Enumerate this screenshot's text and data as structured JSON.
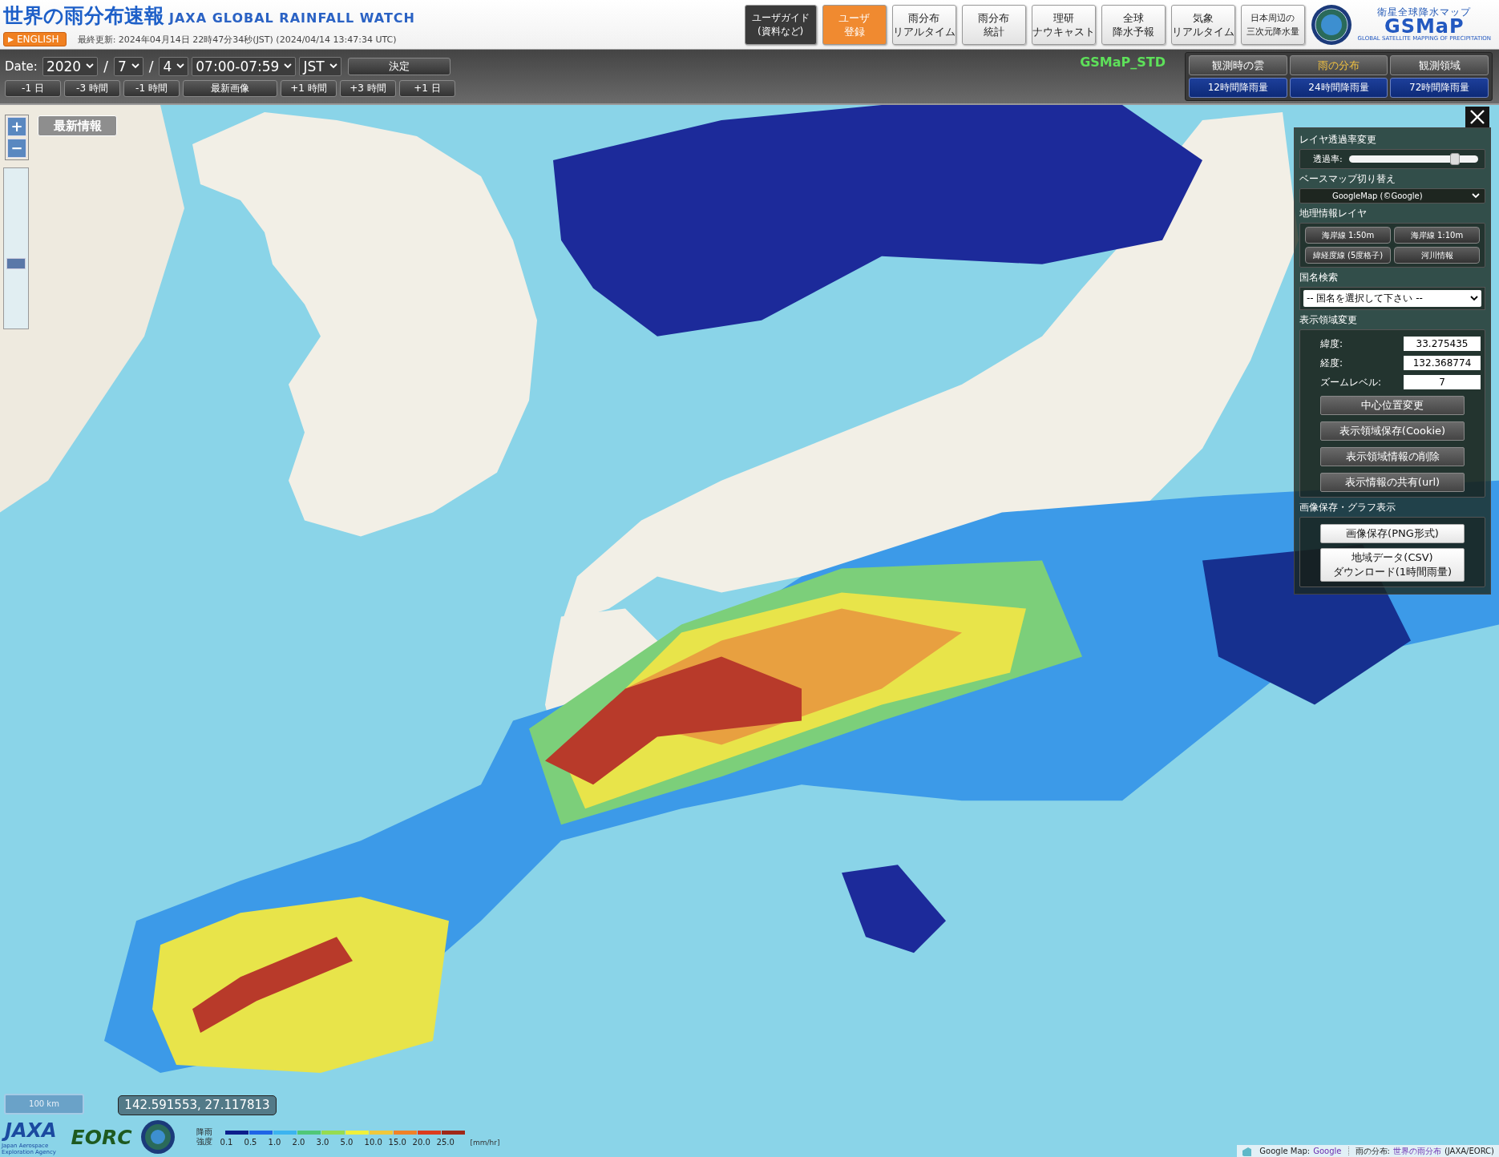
{
  "header": {
    "title": "世界の雨分布速報",
    "subtitle": "JAXA GLOBAL RAINFALL WATCH",
    "language_button": {
      "icon": "▶",
      "label": "ENGLISH"
    },
    "last_updated": "最終更新: 2024年04月14日 22時47分34秒(JST) (2024/04/14 13:47:34 UTC)"
  },
  "nav_buttons": [
    {
      "lines": [
        "ユーザガイド",
        "(資料など)"
      ],
      "kind": "dark"
    },
    {
      "lines": [
        "ユーザ",
        "登録"
      ],
      "kind": "accent"
    },
    {
      "lines": [
        "雨分布",
        "リアルタイム"
      ],
      "kind": "plain"
    },
    {
      "lines": [
        "雨分布",
        "統計"
      ],
      "kind": "plain"
    },
    {
      "lines": [
        "理研",
        "ナウキャスト"
      ],
      "kind": "plain"
    },
    {
      "lines": [
        "全球",
        "降水予報"
      ],
      "kind": "plain"
    },
    {
      "lines": [
        "気象",
        "リアルタイム"
      ],
      "kind": "plain"
    },
    {
      "lines": [
        "日本周辺の",
        "三次元降水量"
      ],
      "kind": "small"
    }
  ],
  "logo": {
    "tagline_ja": "衛星全球降水マップ",
    "name": "GSMaP",
    "tagline_en": "GLOBAL SATELLITE MAPPING OF PRECIPITATION"
  },
  "date_bar": {
    "label": "Date:",
    "fields": [
      {
        "kind": "select",
        "value": "2020"
      },
      {
        "kind": "separator",
        "text": "/"
      },
      {
        "kind": "select",
        "value": "7"
      },
      {
        "kind": "separator",
        "text": "/"
      },
      {
        "kind": "select",
        "value": "4"
      },
      {
        "kind": "select",
        "value": "07:00-07:59"
      },
      {
        "kind": "select",
        "value": "JST"
      },
      {
        "kind": "button",
        "text": "決定"
      }
    ]
  },
  "step_buttons": [
    "-1 日",
    "-3 時間",
    "-1 時間",
    "最新画像",
    "+1 時間",
    "+3 時間",
    "+1 日"
  ],
  "product": "GSMaP_STD",
  "view_tabs": [
    {
      "label": "観測時の雲",
      "selected": false
    },
    {
      "label": "雨の分布",
      "selected": true
    },
    {
      "label": "観測領域",
      "selected": false
    }
  ],
  "accum_buttons": [
    "12時間降雨量",
    "24時間降雨量",
    "72時間降雨量"
  ],
  "map": {
    "kind": "picture",
    "zoom_slider": {
      "level": 0.4
    },
    "latest_button": "最新情報",
    "zoom_in": "+",
    "zoom_out": "−",
    "scale": "100 km",
    "cursor_coords": "142.591553, 27.117813"
  },
  "panel": {
    "opacity": {
      "heading": "レイヤ透過率変更",
      "label": "透過率:",
      "level": 0.82
    },
    "basemap": {
      "heading": "ベースマップ切り替え",
      "value": "GoogleMap (©Google)"
    },
    "geo_layers": {
      "heading": "地理情報レイヤ",
      "buttons": [
        "海岸線 1:50m",
        "海岸線 1:10m",
        "緯経度線 (5度格子)",
        "河川情報"
      ]
    },
    "country": {
      "heading": "国名検索",
      "value": "-- 国名を選択して下さい --"
    },
    "region": {
      "heading": "表示領域変更",
      "fields": [
        {
          "label": "緯度:",
          "value": "33.275435"
        },
        {
          "label": "経度:",
          "value": "132.368774"
        },
        {
          "label": "ズームレベル:",
          "value": "7"
        }
      ],
      "buttons": [
        "中心位置変更",
        "表示領域保存(Cookie)",
        "表示領域情報の削除",
        "表示情報の共有(url)"
      ]
    },
    "export": {
      "heading": "画像保存・グラフ表示",
      "buttons": [
        [
          "画像保存(PNG形式)"
        ],
        [
          "地域データ(CSV)",
          "ダウンロード(1時間雨量)"
        ]
      ]
    }
  },
  "legend": {
    "title_lines": [
      "降雨",
      "強度"
    ],
    "unit": "[mm/hr]",
    "bins": [
      {
        "label": "0.1",
        "color": "#0c1f8c"
      },
      {
        "label": "0.5",
        "color": "#1e64e6"
      },
      {
        "label": "1.0",
        "color": "#3cb4f0"
      },
      {
        "label": "2.0",
        "color": "#50c878"
      },
      {
        "label": "3.0",
        "color": "#96dc50"
      },
      {
        "label": "5.0",
        "color": "#f0f03c"
      },
      {
        "label": "10.0",
        "color": "#f0c83c"
      },
      {
        "label": "15.0",
        "color": "#f08228"
      },
      {
        "label": "20.0",
        "color": "#dc3c1e"
      },
      {
        "label": "25.0",
        "color": "#a02818"
      }
    ]
  },
  "footer_logos": {
    "jaxa": "JAXA",
    "jaxa_sub": [
      "Japan Aerospace",
      "Exploration Agency"
    ],
    "eorc": "EORC"
  },
  "attribution": [
    {
      "kind": "text",
      "text": "Google Map: "
    },
    {
      "kind": "link",
      "text": "Google"
    },
    {
      "kind": "divider"
    },
    {
      "kind": "text",
      "text": "雨の分布: "
    },
    {
      "kind": "link",
      "text": "世界の雨分布"
    },
    {
      "kind": "text",
      "text": "(JAXA/EORC)"
    }
  ]
}
